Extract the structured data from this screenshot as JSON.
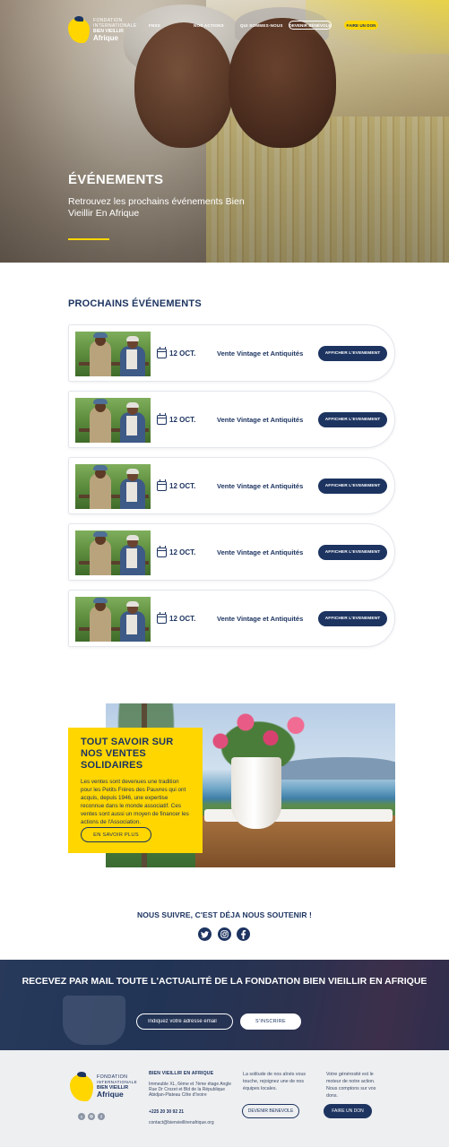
{
  "nav": {
    "logo": {
      "line1": "FONDATION",
      "line2": "INTERNATIONALE",
      "line3": "BIEN VIEILLIR",
      "line4": "Afrique"
    },
    "links": [
      "FNSS",
      "NOS ACTIONS",
      "QUI SOMMES-NOUS"
    ],
    "volunteer_label": "DEVENIR BÉNÉVOLE",
    "donate_label": "FAIRE UN DON"
  },
  "hero": {
    "title": "ÉVÉNEMENTS",
    "subtitle": "Retrouvez les prochains événements Bien Vieillir En Afrique"
  },
  "events": {
    "section_title": "PROCHAINS ÉVÉNEMENTS",
    "items": [
      {
        "date": "12 OCT.",
        "name": "Vente Vintage et Antiquités",
        "button": "AFFICHER L'EVENEMENT"
      },
      {
        "date": "12 OCT.",
        "name": "Vente Vintage et Antiquités",
        "button": "AFFICHER L'EVENEMENT"
      },
      {
        "date": "12 OCT.",
        "name": "Vente Vintage et Antiquités",
        "button": "AFFICHER L'EVENEMENT"
      },
      {
        "date": "12 OCT.",
        "name": "Vente Vintage et Antiquités",
        "button": "AFFICHER L'EVENEMENT"
      },
      {
        "date": "12 OCT.",
        "name": "Vente Vintage et Antiquités",
        "button": "AFFICHER L'EVENEMENT"
      }
    ]
  },
  "promo": {
    "title": "TOUT SAVOIR SUR NOS VENTES SOLIDAIRES",
    "text": "Les ventes sont devenues une tradition pour les Petits Frères des Pauvres qui ont acquis, depuis 1946, une expertise reconnue dans le monde associatif. Ces ventes sont aussi un moyen de financer les actions de l'Association.",
    "button": "EN SAVOIR PLUS"
  },
  "social": {
    "title": "NOUS SUIVRE, C'EST DÉJA NOUS SOUTENIR !",
    "icons": [
      "twitter-icon",
      "instagram-icon",
      "facebook-icon"
    ]
  },
  "newsletter": {
    "title": "RECEVEZ PAR MAIL TOUTE L'ACTUALITÉ DE LA FONDATION BIEN VIEILLIR EN AFRIQUE",
    "input_placeholder": "Indiquez votre adresse email",
    "button": "S'INSCRIRE"
  },
  "footer": {
    "logo": {
      "line1": "FONDATION",
      "line2": "INTERNATIONALE",
      "line3": "BIEN VIEILLIR",
      "line4": "Afrique"
    },
    "col1_title": "BIEN VIEILLIR EN AFRIQUE",
    "address": "Immeuble XL, 6ème et 7ème étage Angle Rue Dr Crozet et Bld de la République Abidjan-Plateau Côte d'Ivoire",
    "phone": "+225 20 30 92 21",
    "email": "contact@bienvieillirenafrique.org",
    "col2_text": "La solitude de nos aînés vous touche, rejoignez une de nos équipes locales.",
    "col2_button": "DEVENIR BENEVOLE",
    "col3_text": "Votre générosité est le moteur de notre action. Nous comptons sur vos dons.",
    "col3_button": "FAIRE UN DON"
  },
  "colors": {
    "navy": "#1d3461",
    "yellow": "#ffd600",
    "footer_bg": "#eeeff1"
  }
}
